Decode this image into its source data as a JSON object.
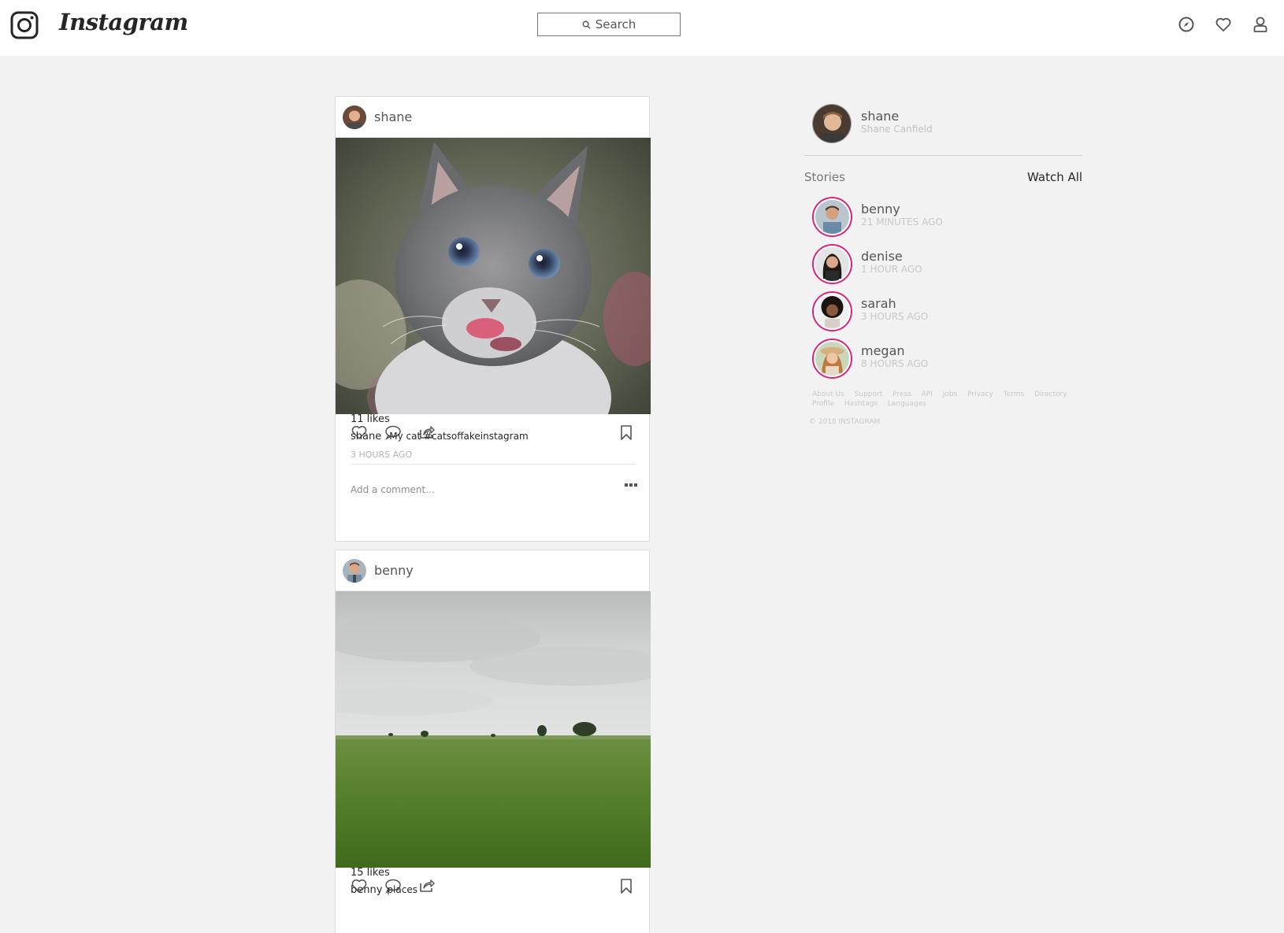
{
  "header": {
    "wordmark": "Instagram",
    "search_placeholder": "Search",
    "icons": [
      "instagram-logo-icon",
      "compass-icon",
      "heart-icon",
      "user-icon"
    ]
  },
  "posts": [
    {
      "username": "shane",
      "image": "kitten-photo",
      "likes": "11 likes",
      "caption_user": "shane",
      "caption_text": "My cat #catsoffakeinstagram",
      "time": "3 HOURS AGO",
      "comment_placeholder": "Add a comment..."
    },
    {
      "username": "benny",
      "image": "field-landscape-photo",
      "likes": "15 likes",
      "caption_user": "benny",
      "caption_text": "places"
    }
  ],
  "sidebar": {
    "username": "shane",
    "full_name": "Shane Canfield",
    "stories_label": "Stories",
    "watch_all": "Watch All",
    "stories": [
      {
        "name": "benny",
        "time": "21 MINUTES AGO"
      },
      {
        "name": "denise",
        "time": "1 HOUR AGO"
      },
      {
        "name": "sarah",
        "time": "3 HOURS AGO"
      },
      {
        "name": "megan",
        "time": "8 HOURS AGO"
      }
    ],
    "footer_links": [
      "About Us",
      "Support",
      "Press",
      "API",
      "Jobs",
      "Privacy",
      "Terms",
      "Directory",
      "Profile",
      "Hashtags",
      "Languages"
    ],
    "copyright": "© 2018 INSTAGRAM"
  },
  "colors": {
    "background": "#f2f2f2",
    "story_ring": "#d6267c",
    "muted_text": "#c8c8c8"
  }
}
